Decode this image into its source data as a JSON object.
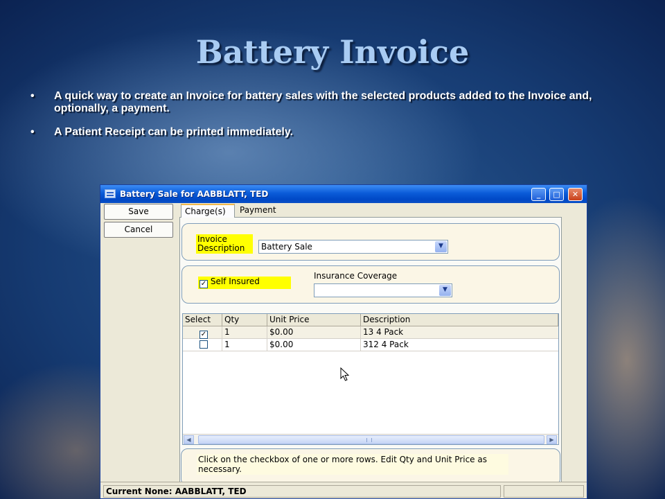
{
  "slide": {
    "title": "Battery Invoice",
    "bullets": [
      "A quick way to create an Invoice for battery sales with the selected products added to the Invoice and, optionally, a payment.",
      "A Patient Receipt can be printed immediately."
    ],
    "bullet_char": "•"
  },
  "window": {
    "title": "Battery Sale for AABBLATT, TED",
    "controls": {
      "minimize": "_",
      "maximize": "□",
      "close": "✕"
    },
    "actions": {
      "save": "Save",
      "cancel": "Cancel"
    },
    "tabs": [
      "Charge(s)",
      "Payment"
    ],
    "invoice": {
      "label_line1": "Invoice",
      "label_line2": "Description",
      "value": "Battery Sale"
    },
    "self_insured": {
      "label": "Self Insured",
      "checked": true
    },
    "insurance": {
      "label": "Insurance Coverage",
      "value": ""
    },
    "grid": {
      "columns": [
        "Select",
        "Qty",
        "Unit Price",
        "Description"
      ],
      "rows": [
        {
          "selected": true,
          "qty": "1",
          "unit_price": "$0.00",
          "description": "13 4 Pack"
        },
        {
          "selected": false,
          "qty": "1",
          "unit_price": "$0.00",
          "description": "312 4 Pack"
        }
      ]
    },
    "hint": "Click on the checkbox of one or more rows. Edit Qty and Unit Price as necessary.",
    "status": "Current None: AABBLATT, TED",
    "glyphs": {
      "checked": "✓",
      "dropdown": "▼",
      "left": "◀",
      "right": "▶"
    }
  }
}
